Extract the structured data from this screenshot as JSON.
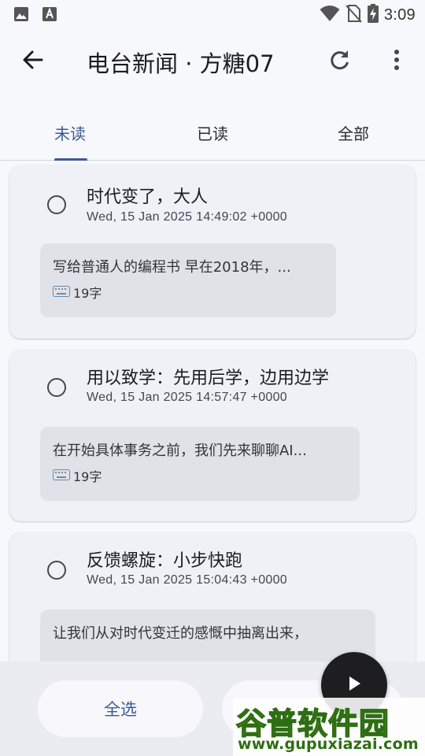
{
  "status_bar": {
    "time": "3:09",
    "left_icons": [
      "image-icon",
      "keyboard-a-icon"
    ],
    "right_icons": [
      "wifi-icon",
      "no-sim-icon",
      "battery-charging-icon"
    ]
  },
  "app_bar": {
    "title": "电台新闻 · 方糖07",
    "back_icon": "arrow-back-icon",
    "refresh_icon": "refresh-icon",
    "more_icon": "more-vert-icon"
  },
  "tabs": [
    {
      "label": "未读",
      "active": true
    },
    {
      "label": "已读",
      "active": false
    },
    {
      "label": "全部",
      "active": false
    }
  ],
  "articles": [
    {
      "title": "时代变了，大人",
      "date": "Wed, 15 Jan 2025 14:49:02 +0000",
      "excerpt": "写给普通人的编程书 早在2018年，...",
      "word_count": "19字"
    },
    {
      "title": "用以致学：先用后学，边用边学",
      "date": "Wed, 15 Jan 2025 14:57:47 +0000",
      "excerpt": "在开始具体事务之前，我们先来聊聊AI...",
      "word_count": "19字"
    },
    {
      "title": "反馈螺旋：小步快跑",
      "date": "Wed, 15 Jan 2025 15:04:43 +0000",
      "excerpt": "让我们从对时代变迁的感慨中抽离出来，",
      "word_count": ""
    }
  ],
  "bottom_bar": {
    "select_all_label": "全选"
  },
  "watermark": {
    "logo": "谷普软件园",
    "url": "www.gupuxiazai.com"
  },
  "colors": {
    "accent": "#3d5a91",
    "background": "#f7f8fc",
    "card": "#f0f1f7",
    "excerpt_bg": "#e1e2e8"
  }
}
